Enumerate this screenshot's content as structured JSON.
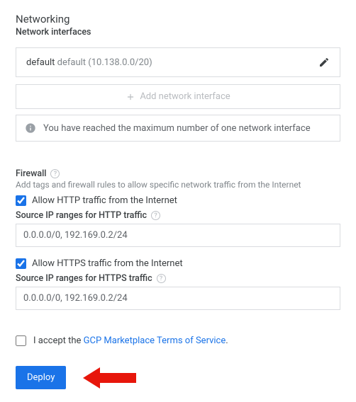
{
  "networking": {
    "title": "Networking",
    "subtitle": "Network interfaces",
    "interface": {
      "name": "default",
      "detail": "default (10.138.0.0/20)"
    },
    "add_label": "Add network interface",
    "limit_msg": "You have reached the maximum number of one network interface"
  },
  "firewall": {
    "title": "Firewall",
    "desc": "Add tags and firewall rules to allow specific network traffic from the Internet",
    "http_label": "Allow HTTP traffic from the Internet",
    "http_ranges_label": "Source IP ranges for HTTP traffic",
    "http_ranges_value": "0.0.0.0/0, 192.169.0.2/24",
    "https_label": "Allow HTTPS traffic from the Internet",
    "https_ranges_label": "Source IP ranges for HTTPS traffic",
    "https_ranges_value": "0.0.0.0/0, 192.169.0.2/24"
  },
  "tos": {
    "prefix": "I accept the ",
    "link_text": "GCP Marketplace Terms of Service",
    "suffix": "."
  },
  "deploy_label": "Deploy"
}
